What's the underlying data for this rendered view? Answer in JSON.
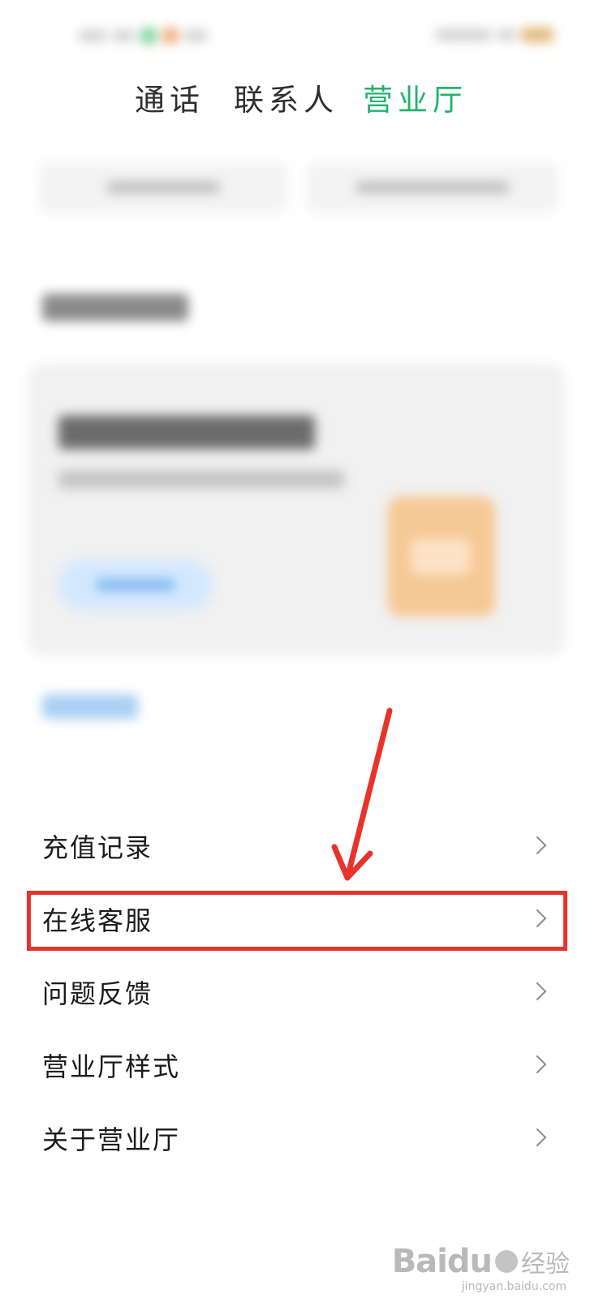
{
  "tabs": [
    {
      "label": "通话",
      "active": false
    },
    {
      "label": "联系人",
      "active": false
    },
    {
      "label": "营业厅",
      "active": true
    }
  ],
  "accent_color": "#22b26b",
  "menu": {
    "items": [
      {
        "label": "充值记录",
        "icon": "chevron-right-icon"
      },
      {
        "label": "在线客服",
        "icon": "chevron-right-icon",
        "highlighted": true
      },
      {
        "label": "问题反馈",
        "icon": "chevron-right-icon"
      },
      {
        "label": "营业厅样式",
        "icon": "chevron-right-icon"
      },
      {
        "label": "关于营业厅",
        "icon": "chevron-right-icon"
      }
    ]
  },
  "annotation": {
    "color": "#e8332c"
  },
  "watermark": {
    "brand": "Baidu",
    "cn": "经验",
    "url": "jingyan.baidu.com"
  }
}
